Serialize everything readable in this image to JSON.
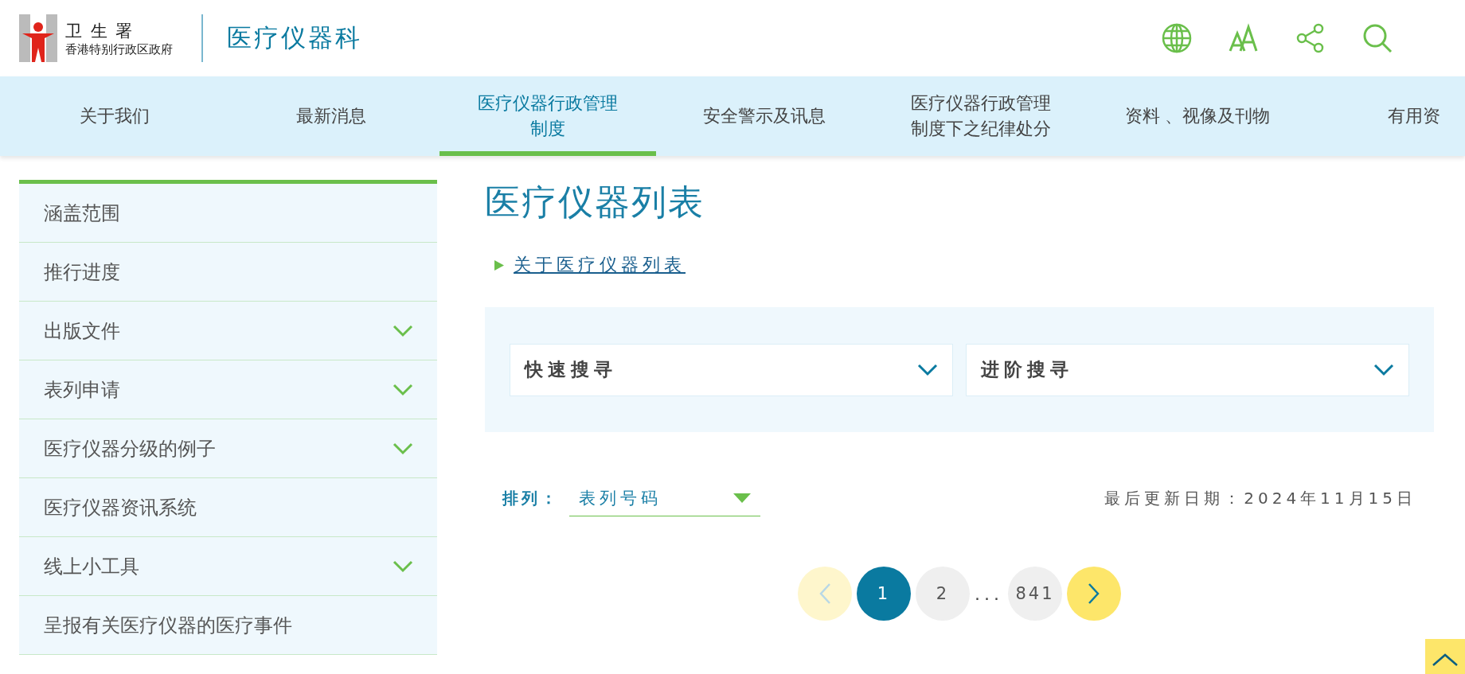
{
  "header": {
    "logo_title": "卫 生 署",
    "logo_subtitle": "香港特别行政区政府",
    "site_title": "医疗仪器科"
  },
  "nav": [
    {
      "label": "关于我们",
      "selected": false
    },
    {
      "label": "最新消息",
      "selected": false
    },
    {
      "label": "医疗仪器行政管理制度",
      "selected": true
    },
    {
      "label": "安全警示及讯息",
      "selected": false
    },
    {
      "label": "医疗仪器行政管理制度下之纪律处分",
      "selected": false
    },
    {
      "label": "资料 、视像及刊物",
      "selected": false
    },
    {
      "label": "有用资",
      "selected": false
    }
  ],
  "sidebar": {
    "items": [
      {
        "label": "涵盖范围",
        "expandable": false
      },
      {
        "label": "推行进度",
        "expandable": false
      },
      {
        "label": "出版文件",
        "expandable": true
      },
      {
        "label": "表列申请",
        "expandable": true
      },
      {
        "label": "医疗仪器分级的例子",
        "expandable": true
      },
      {
        "label": "医疗仪器资讯系统",
        "expandable": false
      },
      {
        "label": "线上小工具",
        "expandable": true
      },
      {
        "label": "呈报有关医疗仪器的医疗事件",
        "expandable": false
      }
    ]
  },
  "content": {
    "title": "医疗仪器列表",
    "link": "关于医疗仪器列表",
    "search_panels": [
      "快速搜寻",
      "进阶搜寻"
    ],
    "sort": {
      "label": "排列：",
      "value": "表列号码"
    },
    "last_updated": "最后更新日期：2024年11月15日",
    "pagination": {
      "prev_disabled": true,
      "pages": [
        {
          "label": "1",
          "selected": true
        },
        {
          "label": "2",
          "selected": false
        }
      ],
      "ellipsis": "...",
      "last": {
        "label": "841",
        "selected": false
      }
    }
  }
}
